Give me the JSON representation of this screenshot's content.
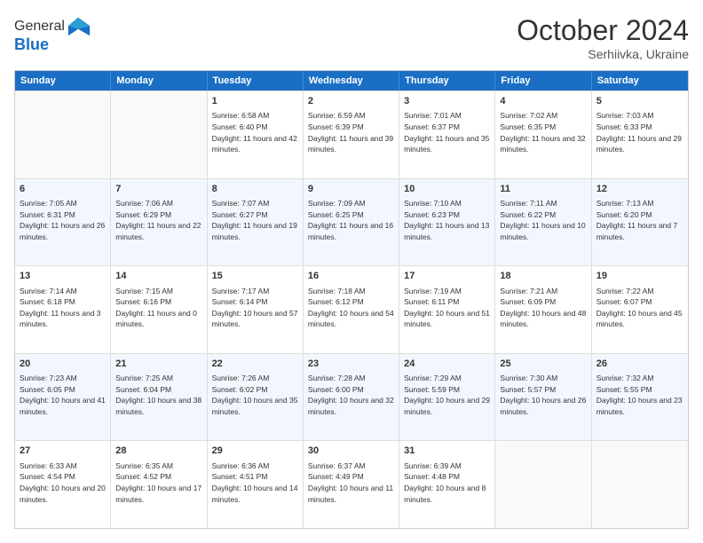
{
  "header": {
    "logo_line1": "General",
    "logo_line2": "Blue",
    "month": "October 2024",
    "location": "Serhiivka, Ukraine"
  },
  "weekdays": [
    "Sunday",
    "Monday",
    "Tuesday",
    "Wednesday",
    "Thursday",
    "Friday",
    "Saturday"
  ],
  "rows": [
    [
      {
        "day": "",
        "sunrise": "",
        "sunset": "",
        "daylight": ""
      },
      {
        "day": "",
        "sunrise": "",
        "sunset": "",
        "daylight": ""
      },
      {
        "day": "1",
        "sunrise": "Sunrise: 6:58 AM",
        "sunset": "Sunset: 6:40 PM",
        "daylight": "Daylight: 11 hours and 42 minutes."
      },
      {
        "day": "2",
        "sunrise": "Sunrise: 6:59 AM",
        "sunset": "Sunset: 6:39 PM",
        "daylight": "Daylight: 11 hours and 39 minutes."
      },
      {
        "day": "3",
        "sunrise": "Sunrise: 7:01 AM",
        "sunset": "Sunset: 6:37 PM",
        "daylight": "Daylight: 11 hours and 35 minutes."
      },
      {
        "day": "4",
        "sunrise": "Sunrise: 7:02 AM",
        "sunset": "Sunset: 6:35 PM",
        "daylight": "Daylight: 11 hours and 32 minutes."
      },
      {
        "day": "5",
        "sunrise": "Sunrise: 7:03 AM",
        "sunset": "Sunset: 6:33 PM",
        "daylight": "Daylight: 11 hours and 29 minutes."
      }
    ],
    [
      {
        "day": "6",
        "sunrise": "Sunrise: 7:05 AM",
        "sunset": "Sunset: 6:31 PM",
        "daylight": "Daylight: 11 hours and 26 minutes."
      },
      {
        "day": "7",
        "sunrise": "Sunrise: 7:06 AM",
        "sunset": "Sunset: 6:29 PM",
        "daylight": "Daylight: 11 hours and 22 minutes."
      },
      {
        "day": "8",
        "sunrise": "Sunrise: 7:07 AM",
        "sunset": "Sunset: 6:27 PM",
        "daylight": "Daylight: 11 hours and 19 minutes."
      },
      {
        "day": "9",
        "sunrise": "Sunrise: 7:09 AM",
        "sunset": "Sunset: 6:25 PM",
        "daylight": "Daylight: 11 hours and 16 minutes."
      },
      {
        "day": "10",
        "sunrise": "Sunrise: 7:10 AM",
        "sunset": "Sunset: 6:23 PM",
        "daylight": "Daylight: 11 hours and 13 minutes."
      },
      {
        "day": "11",
        "sunrise": "Sunrise: 7:11 AM",
        "sunset": "Sunset: 6:22 PM",
        "daylight": "Daylight: 11 hours and 10 minutes."
      },
      {
        "day": "12",
        "sunrise": "Sunrise: 7:13 AM",
        "sunset": "Sunset: 6:20 PM",
        "daylight": "Daylight: 11 hours and 7 minutes."
      }
    ],
    [
      {
        "day": "13",
        "sunrise": "Sunrise: 7:14 AM",
        "sunset": "Sunset: 6:18 PM",
        "daylight": "Daylight: 11 hours and 3 minutes."
      },
      {
        "day": "14",
        "sunrise": "Sunrise: 7:15 AM",
        "sunset": "Sunset: 6:16 PM",
        "daylight": "Daylight: 11 hours and 0 minutes."
      },
      {
        "day": "15",
        "sunrise": "Sunrise: 7:17 AM",
        "sunset": "Sunset: 6:14 PM",
        "daylight": "Daylight: 10 hours and 57 minutes."
      },
      {
        "day": "16",
        "sunrise": "Sunrise: 7:18 AM",
        "sunset": "Sunset: 6:12 PM",
        "daylight": "Daylight: 10 hours and 54 minutes."
      },
      {
        "day": "17",
        "sunrise": "Sunrise: 7:19 AM",
        "sunset": "Sunset: 6:11 PM",
        "daylight": "Daylight: 10 hours and 51 minutes."
      },
      {
        "day": "18",
        "sunrise": "Sunrise: 7:21 AM",
        "sunset": "Sunset: 6:09 PM",
        "daylight": "Daylight: 10 hours and 48 minutes."
      },
      {
        "day": "19",
        "sunrise": "Sunrise: 7:22 AM",
        "sunset": "Sunset: 6:07 PM",
        "daylight": "Daylight: 10 hours and 45 minutes."
      }
    ],
    [
      {
        "day": "20",
        "sunrise": "Sunrise: 7:23 AM",
        "sunset": "Sunset: 6:05 PM",
        "daylight": "Daylight: 10 hours and 41 minutes."
      },
      {
        "day": "21",
        "sunrise": "Sunrise: 7:25 AM",
        "sunset": "Sunset: 6:04 PM",
        "daylight": "Daylight: 10 hours and 38 minutes."
      },
      {
        "day": "22",
        "sunrise": "Sunrise: 7:26 AM",
        "sunset": "Sunset: 6:02 PM",
        "daylight": "Daylight: 10 hours and 35 minutes."
      },
      {
        "day": "23",
        "sunrise": "Sunrise: 7:28 AM",
        "sunset": "Sunset: 6:00 PM",
        "daylight": "Daylight: 10 hours and 32 minutes."
      },
      {
        "day": "24",
        "sunrise": "Sunrise: 7:29 AM",
        "sunset": "Sunset: 5:59 PM",
        "daylight": "Daylight: 10 hours and 29 minutes."
      },
      {
        "day": "25",
        "sunrise": "Sunrise: 7:30 AM",
        "sunset": "Sunset: 5:57 PM",
        "daylight": "Daylight: 10 hours and 26 minutes."
      },
      {
        "day": "26",
        "sunrise": "Sunrise: 7:32 AM",
        "sunset": "Sunset: 5:55 PM",
        "daylight": "Daylight: 10 hours and 23 minutes."
      }
    ],
    [
      {
        "day": "27",
        "sunrise": "Sunrise: 6:33 AM",
        "sunset": "Sunset: 4:54 PM",
        "daylight": "Daylight: 10 hours and 20 minutes."
      },
      {
        "day": "28",
        "sunrise": "Sunrise: 6:35 AM",
        "sunset": "Sunset: 4:52 PM",
        "daylight": "Daylight: 10 hours and 17 minutes."
      },
      {
        "day": "29",
        "sunrise": "Sunrise: 6:36 AM",
        "sunset": "Sunset: 4:51 PM",
        "daylight": "Daylight: 10 hours and 14 minutes."
      },
      {
        "day": "30",
        "sunrise": "Sunrise: 6:37 AM",
        "sunset": "Sunset: 4:49 PM",
        "daylight": "Daylight: 10 hours and 11 minutes."
      },
      {
        "day": "31",
        "sunrise": "Sunrise: 6:39 AM",
        "sunset": "Sunset: 4:48 PM",
        "daylight": "Daylight: 10 hours and 8 minutes."
      },
      {
        "day": "",
        "sunrise": "",
        "sunset": "",
        "daylight": ""
      },
      {
        "day": "",
        "sunrise": "",
        "sunset": "",
        "daylight": ""
      }
    ]
  ]
}
